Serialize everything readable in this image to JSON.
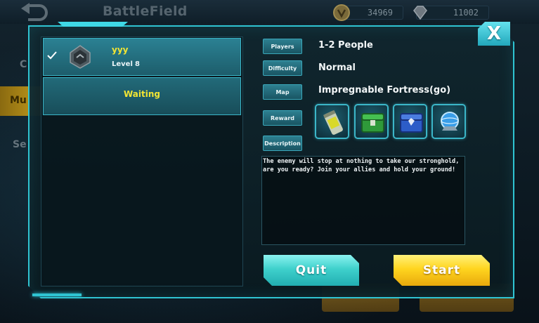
{
  "background": {
    "title": "BattleField",
    "currency": {
      "gold": "34969",
      "gems": "11002"
    },
    "side_tabs": [
      "C",
      "Mu",
      "Se"
    ]
  },
  "dialog": {
    "slots": [
      {
        "name": "yyy",
        "level_label": "Level",
        "level": "8",
        "selected": true
      },
      {
        "status": "Waiting"
      }
    ],
    "fields": {
      "players_label": "Players",
      "players_value": "1-2 People",
      "difficulty_label": "Difficulty",
      "difficulty_value": "Normal",
      "map_label": "Map",
      "map_value": "Impregnable Fortress(go)",
      "reward_label": "Reward",
      "description_label": "Description"
    },
    "rewards": [
      "canister-item-icon",
      "green-chest-icon",
      "blue-chest-icon",
      "orb-item-icon"
    ],
    "description": "The enemy will stop at nothing to take our stronghold, are you ready? Join your allies and hold your ground!",
    "buttons": {
      "quit": "Quit",
      "start": "Start",
      "close": "X"
    }
  },
  "colors": {
    "accent": "#2fc4d2",
    "highlight_text": "#f2e534",
    "quit": "#3fd1cc",
    "start": "#ffd51f"
  }
}
